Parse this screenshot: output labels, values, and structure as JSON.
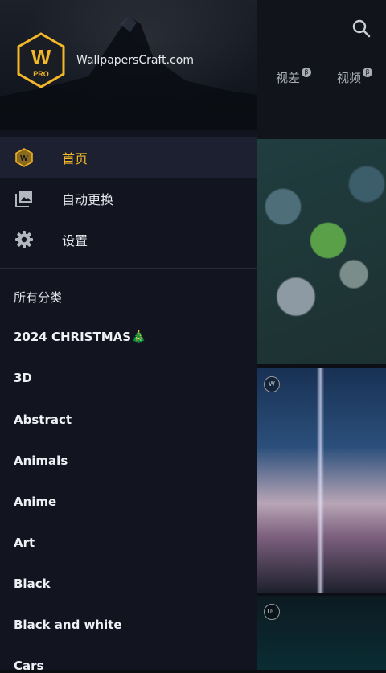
{
  "background": {
    "tabs": [
      {
        "label": "视差",
        "badge": "β"
      },
      {
        "label": "视频",
        "badge": "β"
      }
    ],
    "tiles": [
      {
        "badge": ""
      },
      {
        "badge": "W"
      },
      {
        "badge": "UC"
      }
    ]
  },
  "drawer": {
    "logo": {
      "letter": "W",
      "sub": "PRO"
    },
    "site_name": "WallpapersCraft.com",
    "nav": [
      {
        "label": "首页",
        "icon": "wallpaper-hex-icon",
        "active": true
      },
      {
        "label": "自动更换",
        "icon": "photo-library-icon",
        "active": false
      },
      {
        "label": "设置",
        "icon": "gear-icon",
        "active": false
      }
    ],
    "categories_header": "所有分类",
    "categories": [
      "2024 CHRISTMAS🎄",
      "3D",
      "Abstract",
      "Animals",
      "Anime",
      "Art",
      "Black",
      "Black and white",
      "Cars"
    ]
  },
  "colors": {
    "accent": "#f3b728",
    "drawer_bg": "#121520",
    "active_bg": "#1c2030"
  }
}
